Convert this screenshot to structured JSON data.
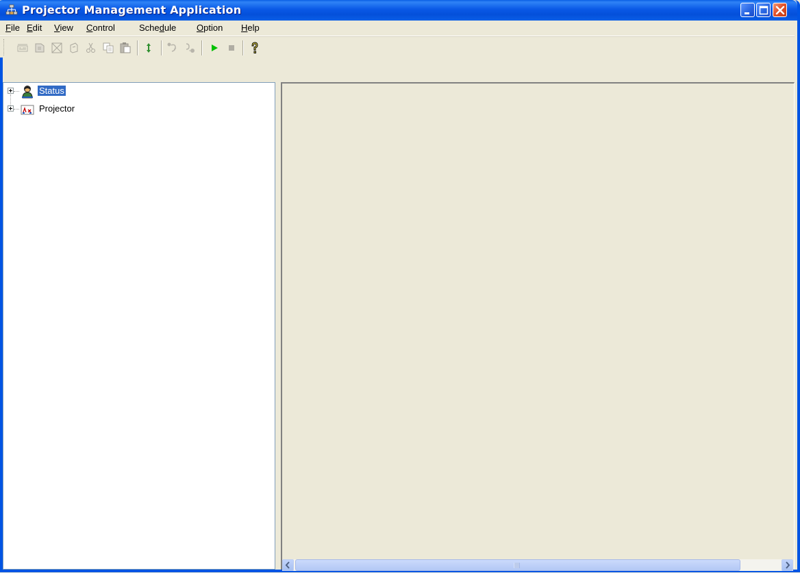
{
  "window": {
    "title": "Projector Management Application",
    "title_icon": "network-icon",
    "controls": [
      "minimize",
      "maximize",
      "close"
    ],
    "accent": "#0054e3",
    "close_color": "#e2542c"
  },
  "menubar": {
    "items": [
      {
        "label": "File",
        "key": "F"
      },
      {
        "label": "Edit",
        "key": "E"
      },
      {
        "label": "View",
        "key": "V"
      },
      {
        "label": "Control",
        "key": "C"
      },
      {
        "label": "Schedule",
        "key": "d"
      },
      {
        "label": "Option",
        "key": "O"
      },
      {
        "label": "Help",
        "key": "H"
      }
    ]
  },
  "toolbar": {
    "buttons": [
      {
        "name": "new-project-icon",
        "enabled": false
      },
      {
        "name": "open-project-icon",
        "enabled": false
      },
      {
        "name": "delete-icon",
        "enabled": false
      },
      {
        "name": "properties-icon",
        "enabled": false
      },
      {
        "name": "cut-icon",
        "enabled": false
      },
      {
        "name": "copy-icon",
        "enabled": false
      },
      {
        "name": "paste-icon",
        "enabled": false
      },
      {
        "name": "refresh-icon",
        "enabled": true
      },
      {
        "name": "connect-icon",
        "enabled": false
      },
      {
        "name": "disconnect-icon",
        "enabled": false
      },
      {
        "name": "play-icon",
        "enabled": true
      },
      {
        "name": "stop-icon",
        "enabled": false
      },
      {
        "name": "help-icon",
        "enabled": true
      }
    ]
  },
  "tree": {
    "nodes": [
      {
        "label": "Status",
        "icon": "status-icon",
        "selected": true,
        "collapsed": true
      },
      {
        "label": "Projector",
        "icon": "projector-icon",
        "selected": false,
        "collapsed": true
      }
    ]
  },
  "scrollbar": {
    "left_arrow": "<",
    "right_arrow": ">"
  },
  "colors": {
    "selection": "#316ac5",
    "face": "#ece9d8",
    "play": "#00c000"
  }
}
